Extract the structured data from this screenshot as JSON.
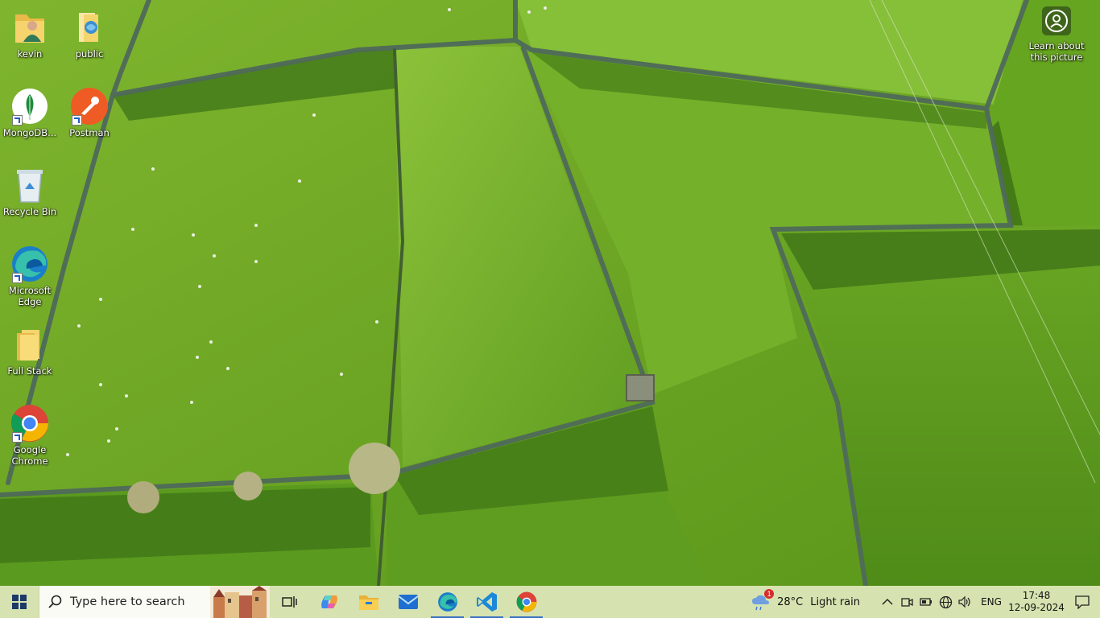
{
  "desktop": {
    "icons": [
      {
        "label": "kevin",
        "icon": "user-folder-icon"
      },
      {
        "label": "public",
        "icon": "public-folder-icon"
      },
      {
        "label": "MongoDB...",
        "icon": "mongodb-icon"
      },
      {
        "label": "Postman",
        "icon": "postman-icon"
      },
      {
        "label": "Recycle Bin",
        "icon": "recycle-bin-icon"
      },
      {
        "label": "Microsoft Edge",
        "icon": "edge-icon"
      },
      {
        "label": "Full Stack",
        "icon": "folder-icon"
      },
      {
        "label": "Google Chrome",
        "icon": "chrome-icon"
      }
    ],
    "learn_about": "Learn about this picture"
  },
  "taskbar": {
    "search_placeholder": "Type here to search",
    "apps": [
      {
        "name": "Task View",
        "icon": "task-view-icon"
      },
      {
        "name": "Copilot",
        "icon": "copilot-icon"
      },
      {
        "name": "File Explorer",
        "icon": "file-explorer-icon"
      },
      {
        "name": "Mail",
        "icon": "mail-icon"
      },
      {
        "name": "Microsoft Edge",
        "icon": "edge-icon"
      },
      {
        "name": "Visual Studio Code",
        "icon": "vscode-icon"
      },
      {
        "name": "Google Chrome",
        "icon": "chrome-icon"
      }
    ],
    "weather": {
      "temp": "28°C",
      "condition": "Light rain",
      "badge": "1"
    },
    "tray": {
      "language": "ENG",
      "time": "17:48",
      "date": "12-09-2024"
    }
  },
  "colors": {
    "taskbar_bg": "#d6e3b0",
    "search_bg": "#fafbf5",
    "grass_main": "#6aa51f",
    "wall": "#4f6a5a"
  }
}
